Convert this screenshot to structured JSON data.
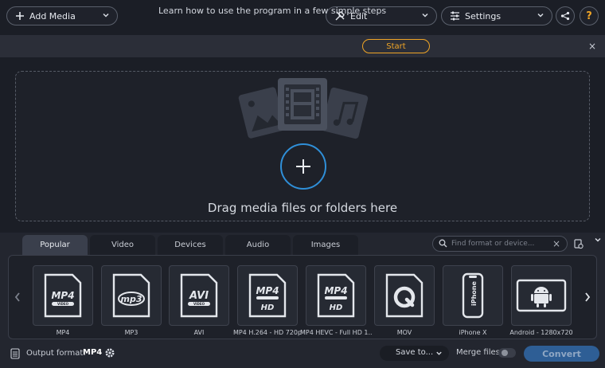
{
  "toolbar": {
    "add_media": "Add Media",
    "edit": "Edit",
    "settings": "Settings",
    "help": "?"
  },
  "banner": {
    "text": "Learn how to use the program in a few simple steps",
    "start": "Start",
    "close": "×"
  },
  "dropzone": {
    "text": "Drag media files or folders here"
  },
  "tabs": [
    "Popular",
    "Video",
    "Devices",
    "Audio",
    "Images"
  ],
  "active_tab": "Popular",
  "search": {
    "placeholder": "Find format or device..."
  },
  "formats": [
    {
      "label": "MP4",
      "badge": "MP4",
      "sub": "VIDEO",
      "icon": "mp4-icon"
    },
    {
      "label": "MP3",
      "badge": "mp3",
      "sub": "",
      "icon": "mp3-icon"
    },
    {
      "label": "AVI",
      "badge": "AVI",
      "sub": "VIDEO",
      "icon": "avi-icon"
    },
    {
      "label": "MP4 H.264 - HD 720p",
      "badge": "MP4",
      "sub": "HD",
      "icon": "mp4-hd-icon"
    },
    {
      "label": "MP4 HEVC - Full HD 1...",
      "badge": "MP4",
      "sub": "HD",
      "icon": "mp4-hevc-icon"
    },
    {
      "label": "MOV",
      "badge": "",
      "sub": "",
      "icon": "quicktime-icon"
    },
    {
      "label": "iPhone X",
      "badge": "iPhone",
      "sub": "",
      "icon": "iphone-icon"
    },
    {
      "label": "Android - 1280x720",
      "badge": "",
      "sub": "",
      "icon": "android-icon"
    }
  ],
  "footer": {
    "output_label": "Output format:",
    "output_value": "MP4",
    "save_to": "Save to...",
    "merge_label": "Merge files:",
    "convert": "Convert"
  },
  "colors": {
    "accent_orange": "#f0a526",
    "accent_blue": "#2f8fd8",
    "convert_bg": "#2e5e95"
  }
}
